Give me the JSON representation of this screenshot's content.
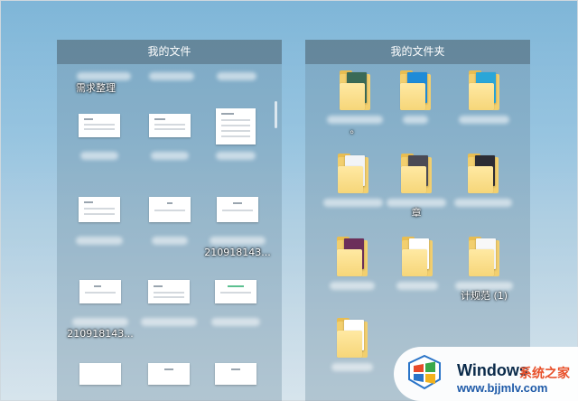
{
  "left_panel": {
    "title": "我的文件",
    "items": [
      {
        "label": "需求整理",
        "label_lines": [
          "需求整理"
        ]
      },
      {
        "label": ""
      },
      {
        "label": ""
      },
      {
        "label": ""
      },
      {
        "label": ""
      },
      {
        "label": ""
      },
      {
        "label": ""
      },
      {
        "label": ""
      },
      {
        "label_lines": [
          "210918143..."
        ]
      },
      {
        "label_lines": [
          "210918143..."
        ]
      },
      {
        "label": ""
      },
      {
        "label": ""
      }
    ]
  },
  "right_panel": {
    "title": "我的文件夹",
    "folders": [
      {
        "label_lines": [
          "。"
        ],
        "doc_color": "#3a6a56"
      },
      {
        "label_lines": [
          ""
        ],
        "doc_color": "#1e8bd8"
      },
      {
        "label_lines": [
          ""
        ],
        "doc_color": "#2aa6d8"
      },
      {
        "label_lines": [
          ""
        ],
        "doc_color": "#f2f4f7"
      },
      {
        "label_lines": [
          "章"
        ],
        "doc_color": "#4a4a55"
      },
      {
        "label_lines": [
          ""
        ],
        "doc_color": "#2c2c34"
      },
      {
        "label_lines": [
          ""
        ],
        "doc_color": "#6c2f5a"
      },
      {
        "label_lines": [
          ""
        ],
        "doc_color": "#ffffff"
      },
      {
        "label_lines": [
          "计规范 (1)"
        ],
        "doc_color": "#f8f8f8"
      },
      {
        "label_lines": [
          ""
        ],
        "doc_color": "#ffffff"
      }
    ]
  },
  "watermark": {
    "title": "Windows",
    "cn": "系统之家",
    "url": "www.bjjmlv.com"
  },
  "colors": {
    "folder": "#f2cf6e",
    "panel_header": "#50697880"
  }
}
